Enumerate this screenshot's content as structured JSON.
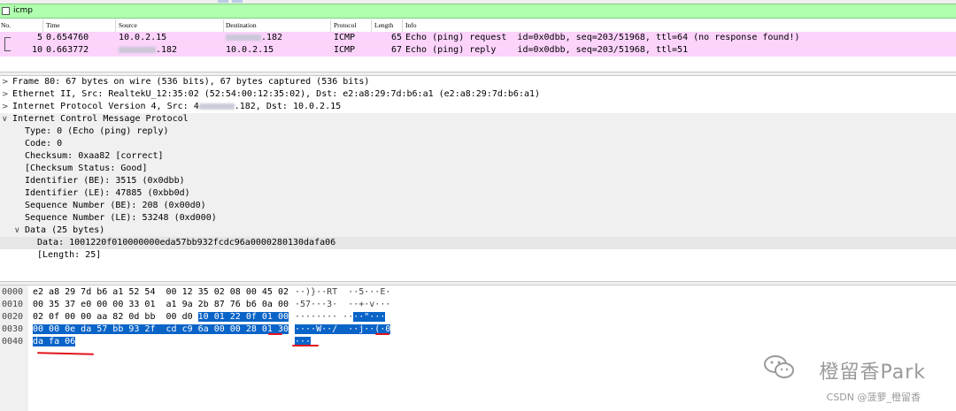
{
  "filter": {
    "text": "icmp"
  },
  "columns": [
    "No.",
    "Time",
    "Source",
    "Destination",
    "Protocol",
    "Length",
    "Info"
  ],
  "packets": [
    {
      "no": "5",
      "time": "0.654760",
      "source": "10.0.2.15",
      "destination_suffix": ".182",
      "protocol": "ICMP",
      "length": "65",
      "info": "Echo (ping) request  id=0x0dbb, seq=203/51968, ttl=64 (no response found!)"
    },
    {
      "no": "10",
      "time": "0.663772",
      "source_suffix": ".182",
      "destination": "10.0.2.15",
      "protocol": "ICMP",
      "length": "67",
      "info": "Echo (ping) reply    id=0x0dbb, seq=203/51968, ttl=51"
    }
  ],
  "details": {
    "frame": "Frame 80: 67 bytes on wire (536 bits), 67 bytes captured (536 bits)",
    "ethernet": "Ethernet II, Src: RealtekU_12:35:02 (52:54:00:12:35:02), Dst: e2:a8:29:7d:b6:a1 (e2:a8:29:7d:b6:a1)",
    "ip_prefix": "Internet Protocol Version 4, Src: 4",
    "ip_suffix": ".182, Dst: 10.0.2.15",
    "icmp": "Internet Control Message Protocol",
    "fields": [
      "Type: 0 (Echo (ping) reply)",
      "Code: 0",
      "Checksum: 0xaa82 [correct]",
      "[Checksum Status: Good]",
      "Identifier (BE): 3515 (0x0dbb)",
      "Identifier (LE): 47885 (0xbb0d)",
      "Sequence Number (BE): 208 (0x00d0)",
      "Sequence Number (LE): 53248 (0xd000)"
    ],
    "data_header": "Data (25 bytes)",
    "data_value": "Data: 1001220f010000000eda57bb932fcdc96a0000280130dafa06",
    "data_length": "[Length: 25]"
  },
  "hex": {
    "offsets": [
      "0000",
      "0010",
      "0020",
      "0030",
      "0040"
    ],
    "row0": "e2 a8 29 7d b6 a1 52 54  00 12 35 02 08 00 45 02",
    "row1": "00 35 37 e0 00 00 33 01  a1 9a 2b 87 76 b6 0a 00",
    "row2_plain": "02 0f 00 00 aa 82 0d bb  00 d0 ",
    "row2_hi": "10 01 22 0f 01 00",
    "row3_hi": "00 00 0e da 57 bb 93 2f  cd c9 6a 00 00 28 01 30",
    "row4_hi": "da fa 06",
    "ascii0": "··)}··RT  ··5···E·",
    "ascii1": "·57···3·  ··+·v···",
    "ascii2_plain": "········ ··",
    "ascii2_hi": "··\"···",
    "ascii3_hi": "····W··/  ··j··(·0",
    "ascii4_hi": "···"
  },
  "watermark": {
    "brand": "橙留香Park",
    "credit": "CSDN @菠萝_橙留香"
  },
  "colors": {
    "filter_bg": "#afffaf",
    "row_bg": "#fbd3fb",
    "selection": "#0a64c8",
    "annotation": "#e0141e"
  }
}
